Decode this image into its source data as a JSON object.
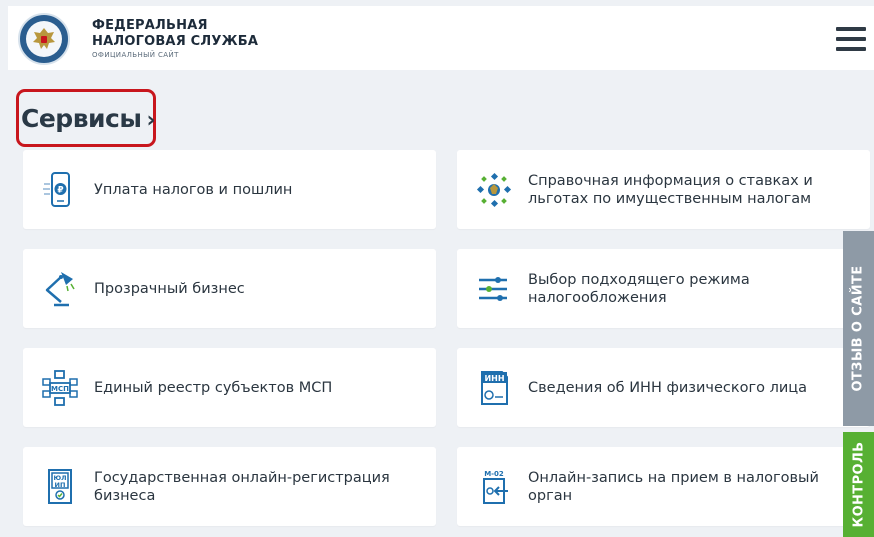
{
  "header": {
    "brand_line1": "ФЕДЕРАЛЬНАЯ",
    "brand_line2": "НАЛОГОВАЯ СЛУЖБА",
    "brand_sub": "ОФИЦИАЛЬНЫЙ САЙТ",
    "logo_text": "ФЕДЕРАЛЬНАЯ НАЛОГОВАЯ СЛУЖБА",
    "menu_icon": "hamburger-icon"
  },
  "section": {
    "title": "Сервисы",
    "chevron": "›"
  },
  "services": [
    {
      "label": "Уплата налогов и пошлин",
      "icon": "payment-phone-icon"
    },
    {
      "label": "Справочная информация о ставках и льготах по имущественным налогам",
      "icon": "reference-info-icon"
    },
    {
      "label": "Прозрачный бизнес",
      "icon": "desk-lamp-icon"
    },
    {
      "label": "Выбор подходящего режима налогообложения",
      "icon": "sliders-icon"
    },
    {
      "label": "Единый реестр субъектов МСП",
      "icon": "msp-registry-icon",
      "icon_text": "МСП"
    },
    {
      "label": "Сведения об ИНН физического лица",
      "icon": "inn-document-icon",
      "icon_text": "ИНН"
    },
    {
      "label": "Государственная онлайн-регистрация бизнеса",
      "icon": "registration-document-icon",
      "icon_text": "ЮЛ ИП"
    },
    {
      "label": "Онлайн-запись на прием в налоговый орган",
      "icon": "appointment-document-icon",
      "icon_text": "М-02"
    }
  ],
  "side_tabs": {
    "feedback": "ОТЗЫВ О САЙТЕ",
    "control": "КОНТРОЛЬ"
  },
  "colors": {
    "accent_blue": "#1f6fae",
    "highlight_red": "#c8161d",
    "feedback_tab": "#8e9aa6",
    "control_tab": "#57b033"
  }
}
